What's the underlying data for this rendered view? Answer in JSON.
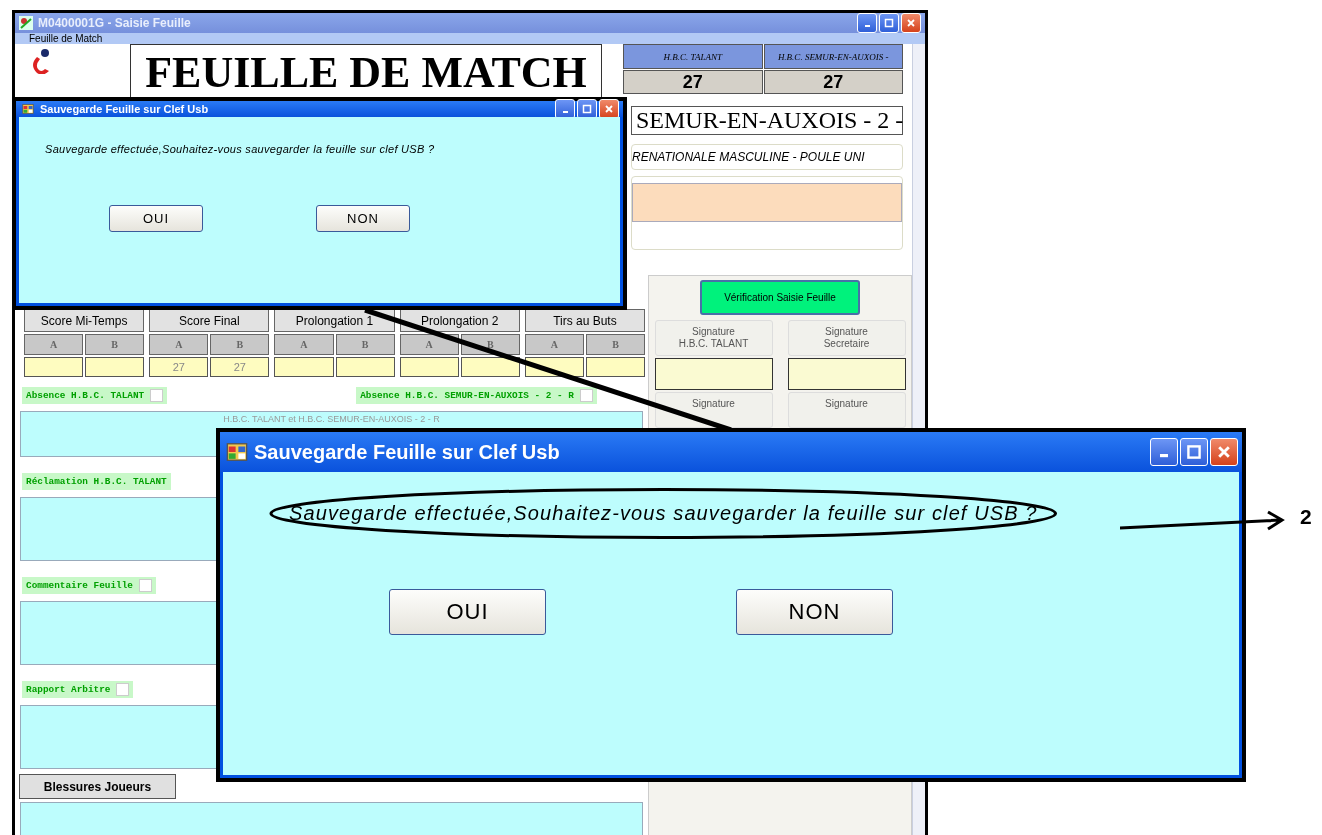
{
  "window": {
    "title": "M0400001G - Saisie Feuille"
  },
  "menu": [
    {
      "label": "Feuille de Match"
    }
  ],
  "header": {
    "title": "FEUILLE DE MATCH",
    "teams_title": "SEMUR-EN-AUXOIS - 2 -",
    "competition": "RENATIONALE MASCULINE - POULE UNI"
  },
  "scoreboard": [
    {
      "team": "H.B.C. TALANT",
      "score": "27"
    },
    {
      "team": "H.B.C. SEMUR-EN-AUXOIS -",
      "score": "27"
    }
  ],
  "score_groups": [
    {
      "label": "Score Mi-Temps",
      "columns": [
        "A",
        "B"
      ]
    },
    {
      "label": "Score Final",
      "columns": [
        "A",
        "B"
      ],
      "values": [
        "27",
        "27"
      ]
    },
    {
      "label": "Prolongation 1",
      "columns": [
        "A",
        "B"
      ]
    },
    {
      "label": "Prolongation 2",
      "columns": [
        "A",
        "B"
      ]
    },
    {
      "label": "Tirs au Buts",
      "columns": [
        "A",
        "B"
      ]
    }
  ],
  "absences": [
    {
      "label": "Absence H.B.C. TALANT",
      "checked": false
    },
    {
      "label": "Absence H.B.C. SEMUR-EN-AUXOIS - 2 - R",
      "checked": false
    }
  ],
  "teams_note": "H.B.C. TALANT et H.B.C. SEMUR-EN-AUXOIS - 2 - R",
  "sections": [
    {
      "label": "Réclamation H.B.C. TALANT"
    },
    {
      "label": "Commentaire Feuille",
      "checked": false
    },
    {
      "label": "Rapport Arbitre",
      "checked": false
    }
  ],
  "injuries_button": "Blessures Joueurs",
  "right_panel": {
    "verify_button": "Vérification Saisie Feuille",
    "signatures": [
      {
        "label": "Signature\nH.B.C. TALANT"
      },
      {
        "label": "Signature\nSecretaire"
      },
      {
        "label": "Signature"
      },
      {
        "label": "Signature"
      }
    ]
  },
  "dialog": {
    "title": "Sauvegarde Feuille sur Clef Usb",
    "message": "Sauvegarde effectuée,Souhaitez-vous sauvegarder la feuille sur clef USB ?",
    "buttons": [
      "OUI",
      "NON"
    ]
  },
  "callout": {
    "title": "Sauvegarde Feuille sur Clef Usb",
    "message": "Sauvegarde effectuée,Souhaitez-vous sauvegarder la feuille sur clef USB ?",
    "buttons": [
      "OUI",
      "NON"
    ],
    "marker": "2"
  }
}
